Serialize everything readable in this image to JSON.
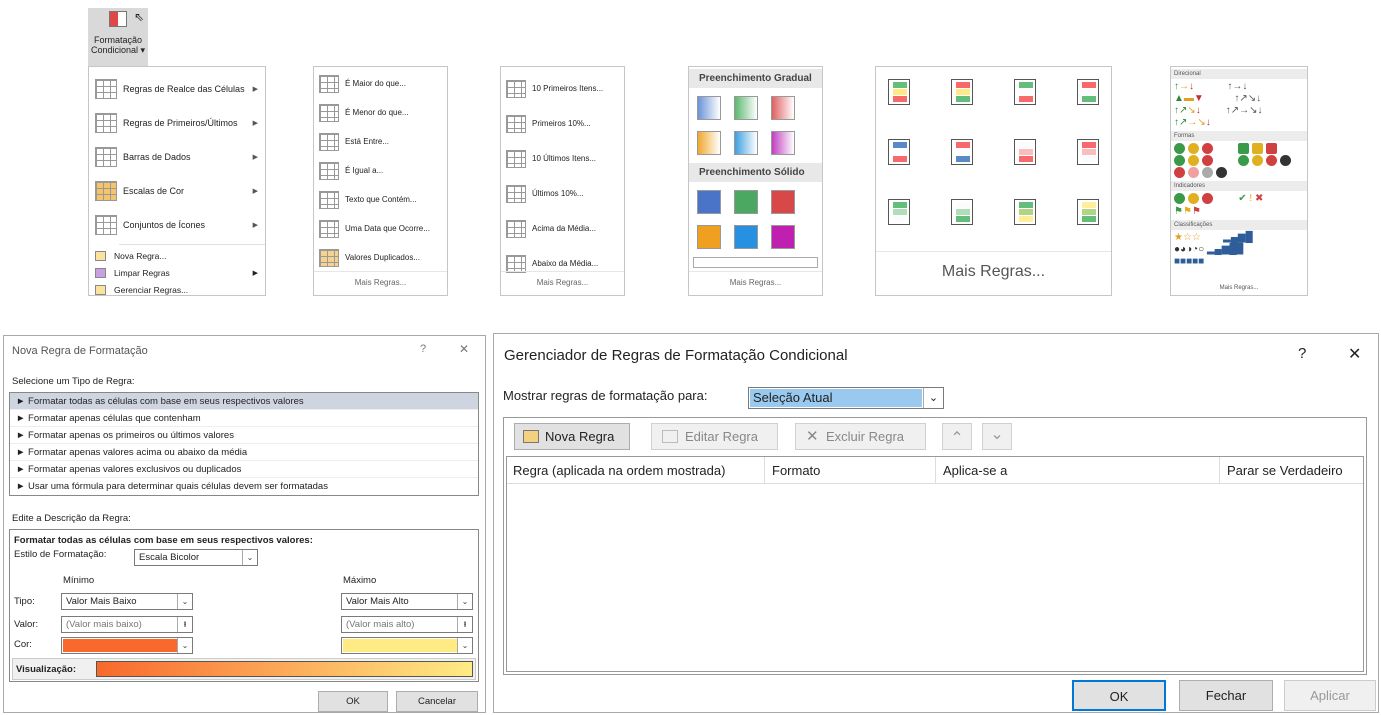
{
  "ribbon": {
    "line1": "Formatação",
    "line2": "Condicional ▾"
  },
  "menu": {
    "items": [
      {
        "label": "Regras de Realce das Células"
      },
      {
        "label": "Regras de Primeiros/Últimos"
      },
      {
        "label": "Barras de Dados"
      },
      {
        "label": "Escalas de Cor"
      },
      {
        "label": "Conjuntos de Ícones"
      }
    ],
    "small": [
      "Nova Regra...",
      "Limpar Regras",
      "Gerenciar Regras..."
    ]
  },
  "sub1": {
    "items": [
      "É Maior do que...",
      "É Menor do que...",
      "Está Entre...",
      "É Igual a...",
      "Texto que Contém...",
      "Uma Data que Ocorre...",
      "Valores Duplicados..."
    ],
    "more": "Mais Regras..."
  },
  "sub2": {
    "items": [
      "10 Primeiros Itens...",
      "Primeiros 10%...",
      "10 Últimos Itens...",
      "Últimos 10%...",
      "Acima da Média...",
      "Abaixo da Média..."
    ],
    "more": "Mais Regras..."
  },
  "sub3": {
    "h1": "Preenchimento Gradual",
    "h2": "Preenchimento Sólido",
    "more": "Mais Regras..."
  },
  "sub4": {
    "more": "Mais Regras..."
  },
  "sub5": {
    "h1": "Direcional",
    "h2": "Formas",
    "h3": "Indicadores",
    "h4": "Classificações",
    "more": "Mais Regras..."
  },
  "dlg1": {
    "title": "Nova Regra de Formatação",
    "help": "?",
    "close": "✕",
    "select_label": "Selecione um Tipo de Regra:",
    "types": [
      "► Formatar todas as células com base em seus respectivos valores",
      "► Formatar apenas células que contenham",
      "► Formatar apenas os primeiros ou últimos valores",
      "► Formatar apenas valores acima ou abaixo da média",
      "► Formatar apenas valores exclusivos ou duplicados",
      "► Usar uma fórmula para determinar quais células devem ser formatadas"
    ],
    "edit_label": "Edite a Descrição da Regra:",
    "desc": "Formatar todas as células com base em seus respectivos valores:",
    "style_label": "Estilo de Formatação:",
    "style_value": "Escala Bicolor",
    "min": "Mínimo",
    "max": "Máximo",
    "tipo": "Tipo:",
    "valor": "Valor:",
    "cor": "Cor:",
    "min_type": "Valor Mais Baixo",
    "max_type": "Valor Mais Alto",
    "min_val": "(Valor mais baixo)",
    "max_val": "(Valor mais alto)",
    "preview": "Visualização:",
    "ok": "OK",
    "cancel": "Cancelar"
  },
  "dlg2": {
    "title": "Gerenciador de Regras de Formatação Condicional",
    "help": "?",
    "close": "✕",
    "show_label": "Mostrar regras de formatação para:",
    "show_value": "Seleção Atual",
    "new": "Nova Regra",
    "edit": "Editar Regra",
    "delete": "Excluir Regra",
    "up": "⌃",
    "down": "⌄",
    "cols": [
      "Regra (aplicada na ordem mostrada)",
      "Formato",
      "Aplica-se a",
      "Parar se Verdadeiro"
    ],
    "ok": "OK",
    "close_btn": "Fechar",
    "apply": "Aplicar"
  }
}
